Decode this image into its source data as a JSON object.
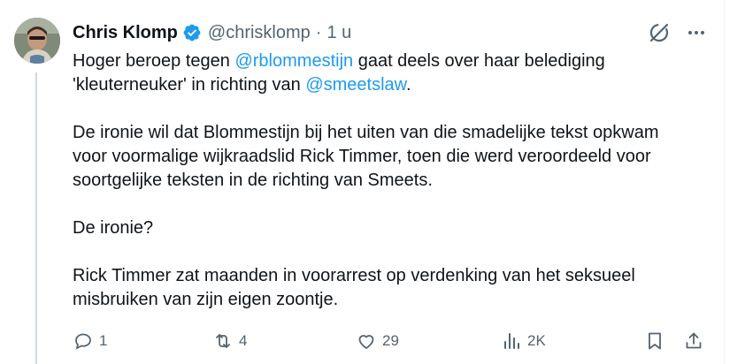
{
  "tweet": {
    "author_name": "Chris Klomp",
    "handle": "@chrisklomp",
    "separator": "·",
    "time": "1 u",
    "body": {
      "p1_part1": "Hoger beroep tegen ",
      "p1_mention1": "@rblommestijn",
      "p1_part2": " gaat deels over haar belediging",
      "p1_part3": "'kleuterneuker' in richting van ",
      "p1_mention2": "@smeetslaw",
      "p1_part4": ".",
      "p2_line1": "De ironie wil dat Blommestijn bij het uiten van die smadelijke tekst opkwam",
      "p2_line2": "voor voormalige wijkraadslid Rick Timmer, toen die werd veroordeeld voor",
      "p2_line3": "soortgelijke teksten in de richting van Smeets.",
      "p3": "De ironie?",
      "p4_line1": "Rick Timmer zat maanden in voorarrest op verdenking van het seksueel",
      "p4_line2": "misbruiken van zijn eigen zoontje."
    },
    "actions": {
      "replies": "1",
      "reposts": "4",
      "likes": "29",
      "views": "2K"
    }
  },
  "colors": {
    "text": "#0f1419",
    "secondary": "#536471",
    "link": "#1d9bf0",
    "verified": "#1d9bf0",
    "thread_line": "#cfd9de"
  }
}
